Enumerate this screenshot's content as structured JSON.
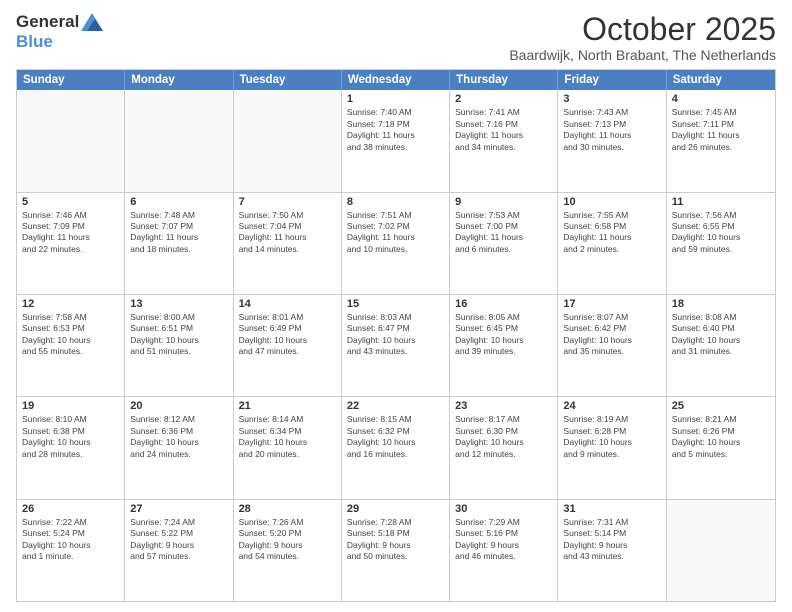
{
  "logo": {
    "general": "General",
    "blue": "Blue"
  },
  "title": "October 2025",
  "subtitle": "Baardwijk, North Brabant, The Netherlands",
  "header_days": [
    "Sunday",
    "Monday",
    "Tuesday",
    "Wednesday",
    "Thursday",
    "Friday",
    "Saturday"
  ],
  "rows": [
    [
      {
        "day": "",
        "info": ""
      },
      {
        "day": "",
        "info": ""
      },
      {
        "day": "",
        "info": ""
      },
      {
        "day": "1",
        "info": "Sunrise: 7:40 AM\nSunset: 7:18 PM\nDaylight: 11 hours\nand 38 minutes."
      },
      {
        "day": "2",
        "info": "Sunrise: 7:41 AM\nSunset: 7:16 PM\nDaylight: 11 hours\nand 34 minutes."
      },
      {
        "day": "3",
        "info": "Sunrise: 7:43 AM\nSunset: 7:13 PM\nDaylight: 11 hours\nand 30 minutes."
      },
      {
        "day": "4",
        "info": "Sunrise: 7:45 AM\nSunset: 7:11 PM\nDaylight: 11 hours\nand 26 minutes."
      }
    ],
    [
      {
        "day": "5",
        "info": "Sunrise: 7:46 AM\nSunset: 7:09 PM\nDaylight: 11 hours\nand 22 minutes."
      },
      {
        "day": "6",
        "info": "Sunrise: 7:48 AM\nSunset: 7:07 PM\nDaylight: 11 hours\nand 18 minutes."
      },
      {
        "day": "7",
        "info": "Sunrise: 7:50 AM\nSunset: 7:04 PM\nDaylight: 11 hours\nand 14 minutes."
      },
      {
        "day": "8",
        "info": "Sunrise: 7:51 AM\nSunset: 7:02 PM\nDaylight: 11 hours\nand 10 minutes."
      },
      {
        "day": "9",
        "info": "Sunrise: 7:53 AM\nSunset: 7:00 PM\nDaylight: 11 hours\nand 6 minutes."
      },
      {
        "day": "10",
        "info": "Sunrise: 7:55 AM\nSunset: 6:58 PM\nDaylight: 11 hours\nand 2 minutes."
      },
      {
        "day": "11",
        "info": "Sunrise: 7:56 AM\nSunset: 6:55 PM\nDaylight: 10 hours\nand 59 minutes."
      }
    ],
    [
      {
        "day": "12",
        "info": "Sunrise: 7:58 AM\nSunset: 6:53 PM\nDaylight: 10 hours\nand 55 minutes."
      },
      {
        "day": "13",
        "info": "Sunrise: 8:00 AM\nSunset: 6:51 PM\nDaylight: 10 hours\nand 51 minutes."
      },
      {
        "day": "14",
        "info": "Sunrise: 8:01 AM\nSunset: 6:49 PM\nDaylight: 10 hours\nand 47 minutes."
      },
      {
        "day": "15",
        "info": "Sunrise: 8:03 AM\nSunset: 6:47 PM\nDaylight: 10 hours\nand 43 minutes."
      },
      {
        "day": "16",
        "info": "Sunrise: 8:05 AM\nSunset: 6:45 PM\nDaylight: 10 hours\nand 39 minutes."
      },
      {
        "day": "17",
        "info": "Sunrise: 8:07 AM\nSunset: 6:42 PM\nDaylight: 10 hours\nand 35 minutes."
      },
      {
        "day": "18",
        "info": "Sunrise: 8:08 AM\nSunset: 6:40 PM\nDaylight: 10 hours\nand 31 minutes."
      }
    ],
    [
      {
        "day": "19",
        "info": "Sunrise: 8:10 AM\nSunset: 6:38 PM\nDaylight: 10 hours\nand 28 minutes."
      },
      {
        "day": "20",
        "info": "Sunrise: 8:12 AM\nSunset: 6:36 PM\nDaylight: 10 hours\nand 24 minutes."
      },
      {
        "day": "21",
        "info": "Sunrise: 8:14 AM\nSunset: 6:34 PM\nDaylight: 10 hours\nand 20 minutes."
      },
      {
        "day": "22",
        "info": "Sunrise: 8:15 AM\nSunset: 6:32 PM\nDaylight: 10 hours\nand 16 minutes."
      },
      {
        "day": "23",
        "info": "Sunrise: 8:17 AM\nSunset: 6:30 PM\nDaylight: 10 hours\nand 12 minutes."
      },
      {
        "day": "24",
        "info": "Sunrise: 8:19 AM\nSunset: 6:28 PM\nDaylight: 10 hours\nand 9 minutes."
      },
      {
        "day": "25",
        "info": "Sunrise: 8:21 AM\nSunset: 6:26 PM\nDaylight: 10 hours\nand 5 minutes."
      }
    ],
    [
      {
        "day": "26",
        "info": "Sunrise: 7:22 AM\nSunset: 5:24 PM\nDaylight: 10 hours\nand 1 minute."
      },
      {
        "day": "27",
        "info": "Sunrise: 7:24 AM\nSunset: 5:22 PM\nDaylight: 9 hours\nand 57 minutes."
      },
      {
        "day": "28",
        "info": "Sunrise: 7:26 AM\nSunset: 5:20 PM\nDaylight: 9 hours\nand 54 minutes."
      },
      {
        "day": "29",
        "info": "Sunrise: 7:28 AM\nSunset: 5:18 PM\nDaylight: 9 hours\nand 50 minutes."
      },
      {
        "day": "30",
        "info": "Sunrise: 7:29 AM\nSunset: 5:16 PM\nDaylight: 9 hours\nand 46 minutes."
      },
      {
        "day": "31",
        "info": "Sunrise: 7:31 AM\nSunset: 5:14 PM\nDaylight: 9 hours\nand 43 minutes."
      },
      {
        "day": "",
        "info": ""
      }
    ]
  ]
}
